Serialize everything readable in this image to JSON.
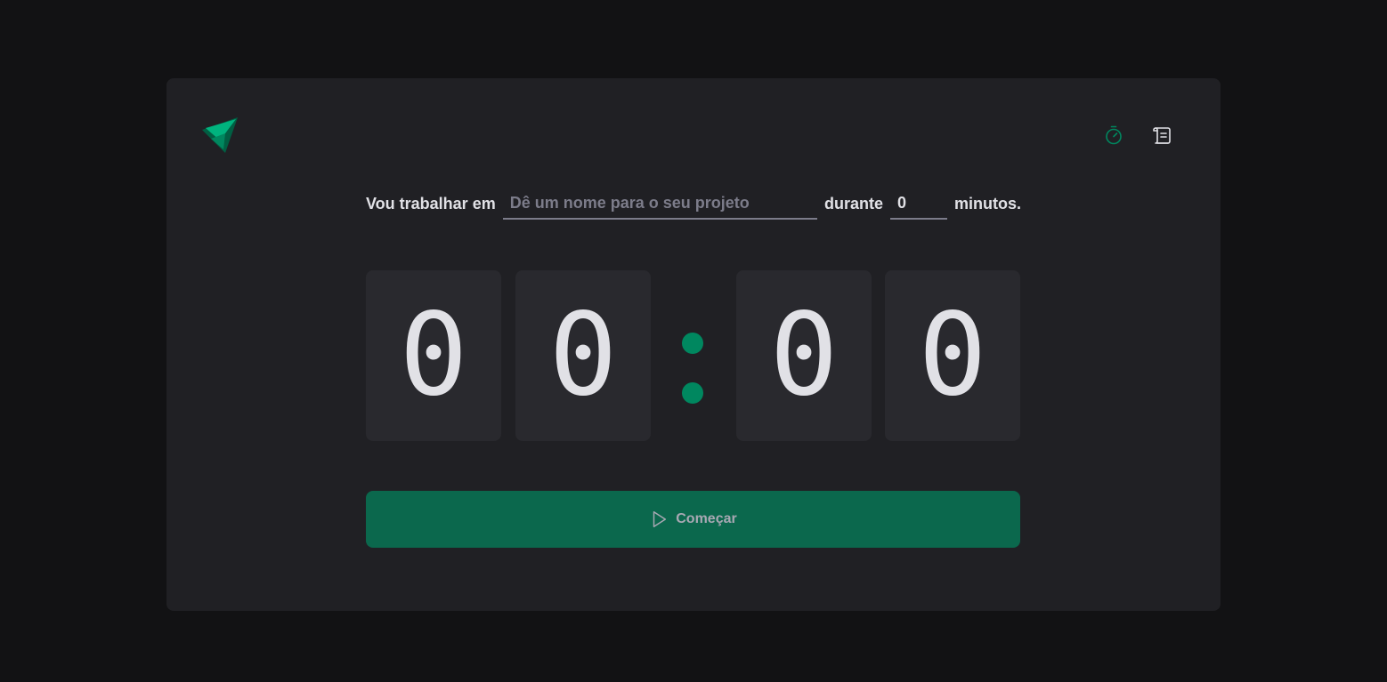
{
  "header": {
    "logo_icon": "triangle-logo-icon",
    "nav": [
      {
        "icon": "timer-icon",
        "active": true
      },
      {
        "icon": "scroll-icon",
        "active": false
      }
    ]
  },
  "form": {
    "label_task": "Vou trabalhar em",
    "task_placeholder": "Dê um nome para o seu projeto",
    "task_value": "",
    "label_duration": "durante",
    "minutes_value": "0",
    "label_minutes": "minutos."
  },
  "countdown": {
    "minutes": [
      "0",
      "0"
    ],
    "seconds": [
      "0",
      "0"
    ],
    "separator": ":"
  },
  "start_button": {
    "label": "Começar",
    "icon": "play-icon"
  },
  "colors": {
    "background": "#121214",
    "card": "#202024",
    "digit_box": "#29292e",
    "accent": "#00875f",
    "button": "#0b684d",
    "text": "#e1e1e6",
    "muted": "#7c7c8a"
  }
}
